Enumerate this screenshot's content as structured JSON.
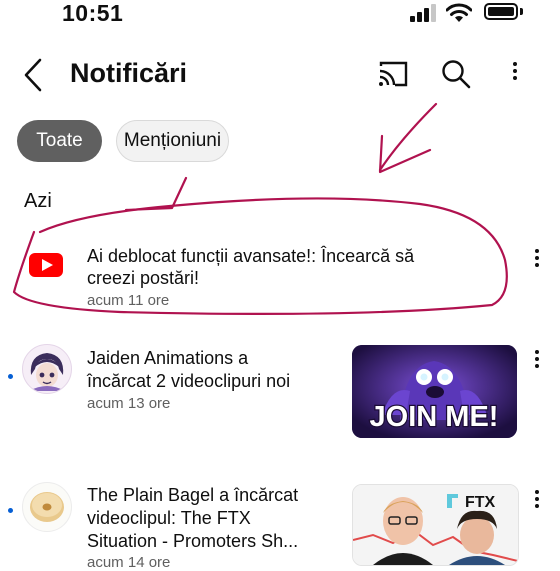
{
  "status_bar": {
    "time": "10:51"
  },
  "header": {
    "title": "Notificări"
  },
  "filters": [
    {
      "label": "Toate",
      "selected": true
    },
    {
      "label": "Menționiuni",
      "selected": false
    }
  ],
  "section": {
    "label": "Azi"
  },
  "notifications": [
    {
      "text_line1": "Ai deblocat funcții avansate!: Încearcă să",
      "text_line2": "creezi postări!",
      "time": "acum 11 ore",
      "unread": false
    },
    {
      "text_line1": "Jaiden Animations a",
      "text_line2": "încărcat 2 videoclipuri noi",
      "time": "acum 13 ore",
      "unread": true,
      "thumb_text": "JOIN ME!"
    },
    {
      "text_line1": "The Plain Bagel a încărcat",
      "text_line2": "videoclipul: The FTX",
      "text_line3": "Situation - Promoters Sh...",
      "time": "acum 14 ore",
      "unread": true,
      "thumb_text": "FTX"
    }
  ],
  "colors": {
    "accent_red": "#ff0000",
    "annotation": "#b0124f",
    "chip_selected": "#606060",
    "unread_dot": "#065fd4"
  }
}
